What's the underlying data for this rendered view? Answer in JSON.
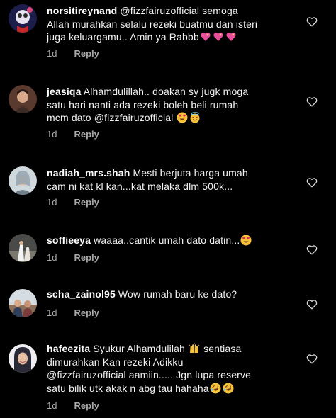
{
  "comments": [
    {
      "username": "norsitireynand",
      "text": " @fizzfairuzofficial semoga\nAllah murahkan selalu rezeki buatmu dan isteri\njuga keluargamu.. Amin ya Rabbb",
      "emojis": [
        "sparkling-heart",
        "sparkling-heart",
        "sparkling-heart"
      ],
      "time": "1d",
      "reply": "Reply"
    },
    {
      "username": "jeasiqa",
      "text": " Alhamdulillah.. doakan sy jugk moga\nsatu hari nanti ada rezeki boleh beli rumah\nmcm dato @fizzfairuzofficial",
      "emojis": [
        "heart-eyes-face",
        "halo-face"
      ],
      "time": "1d",
      "reply": "Reply"
    },
    {
      "username": "nadiah_mrs.shah",
      "text": " Mesti berjuta harga umah\ncam ni kat kl kan...kat melaka dlm 500k...",
      "emojis": [],
      "time": "1d",
      "reply": "Reply"
    },
    {
      "username": "soffieeya",
      "text": " waaaa..cantik umah dato datin...",
      "emojis": [
        "heart-eyes-face"
      ],
      "time": "1d",
      "reply": "Reply"
    },
    {
      "username": "scha_zainol95",
      "text": " Wow rumah baru ke dato?",
      "emojis": [],
      "time": "1d",
      "reply": "Reply"
    },
    {
      "username": "hafeezita",
      "text": " Syukur Alhamdulilah ",
      "text2": " sentiasa\ndimurahkan Kan rezeki Adikku\n@fizzfairuzofficial aamiin..... Jgn lupa reserve\nsatu bilik utk akak n abg tau hahaha",
      "emojis_inline": [
        "raising-hands"
      ],
      "emojis": [
        "rolling-laughing-face",
        "rolling-laughing-face"
      ],
      "time": "1d",
      "reply": "Reply"
    }
  ],
  "icons": {
    "like": "heart-outline-icon"
  },
  "colors": {
    "background": "#000000",
    "text": "#f2f2f2",
    "meta": "#a8a8a8"
  }
}
